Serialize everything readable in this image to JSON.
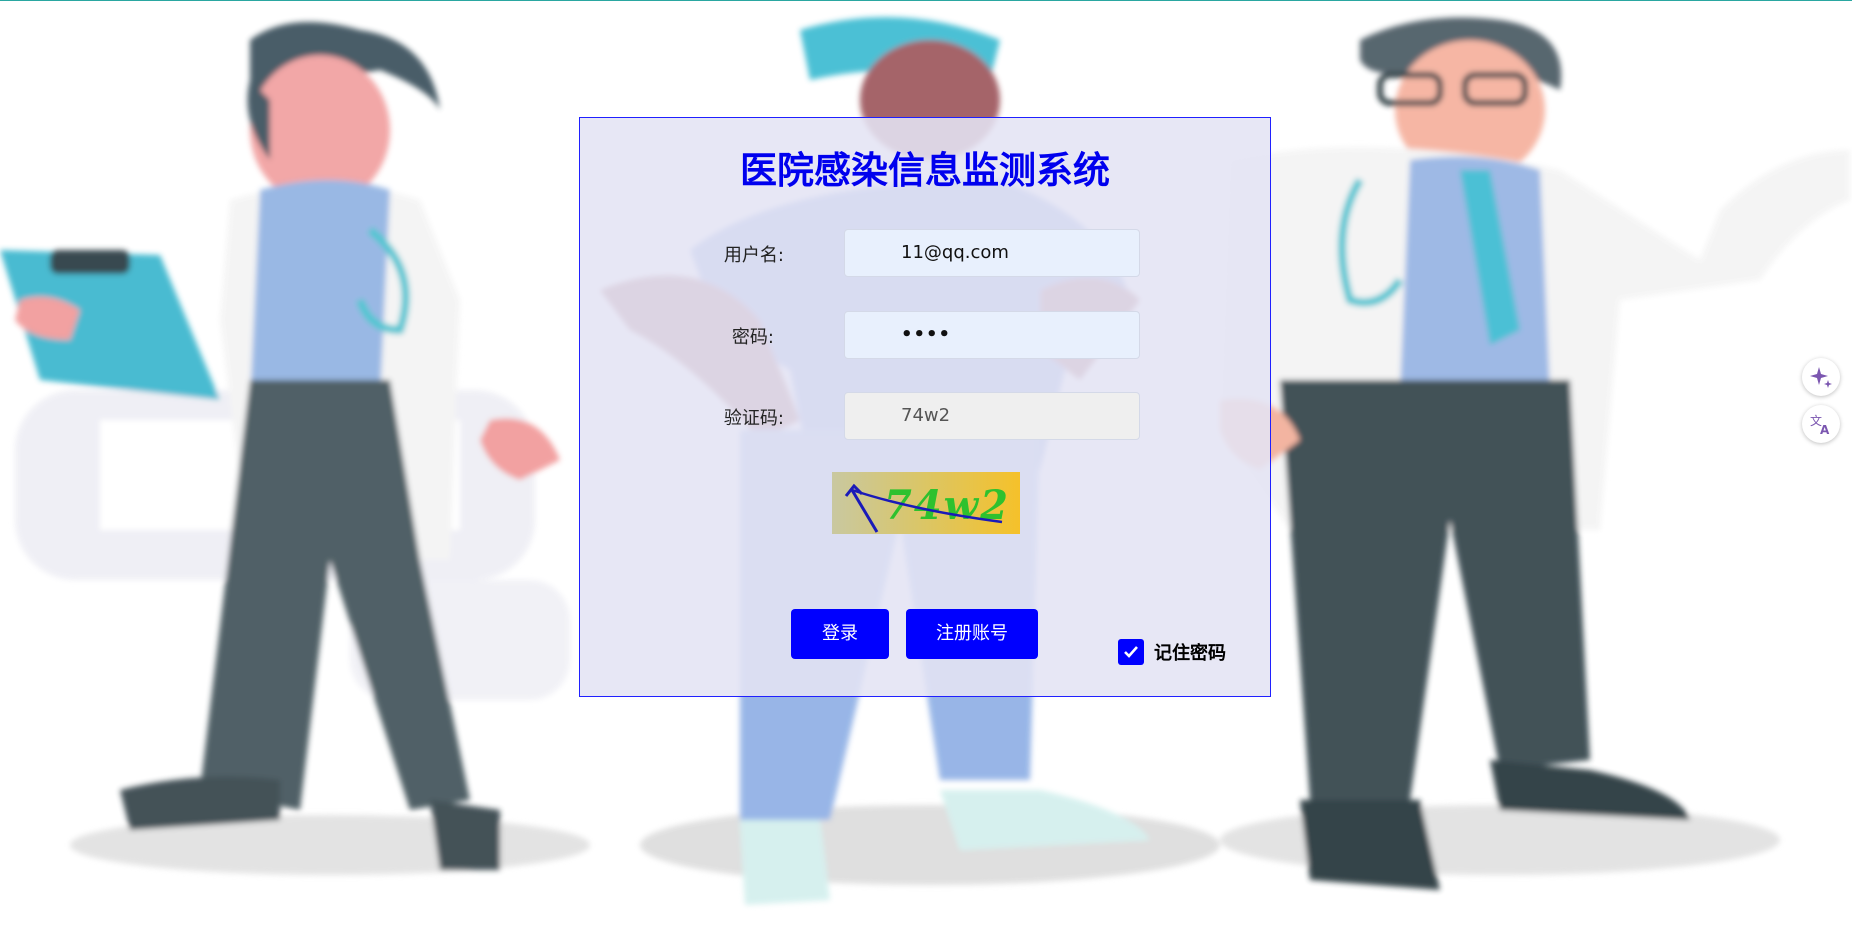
{
  "login": {
    "title": "医院感染信息监测系统",
    "username_label": "用户名:",
    "username_value": "11@qq.com",
    "password_label": "密码:",
    "password_value": "••••",
    "captcha_label": "验证码:",
    "captcha_value": "74w2",
    "captcha_image_text": "74w2",
    "login_button": "登录",
    "register_button": "注册账号",
    "remember_label": "记住密码",
    "remember_checked": true
  },
  "side_tools": {
    "icons": [
      "sparkle-icon",
      "translate-icon"
    ]
  },
  "colors": {
    "accent": "#0000ff",
    "title": "#0000ee",
    "panel_border": "#2020ff"
  }
}
